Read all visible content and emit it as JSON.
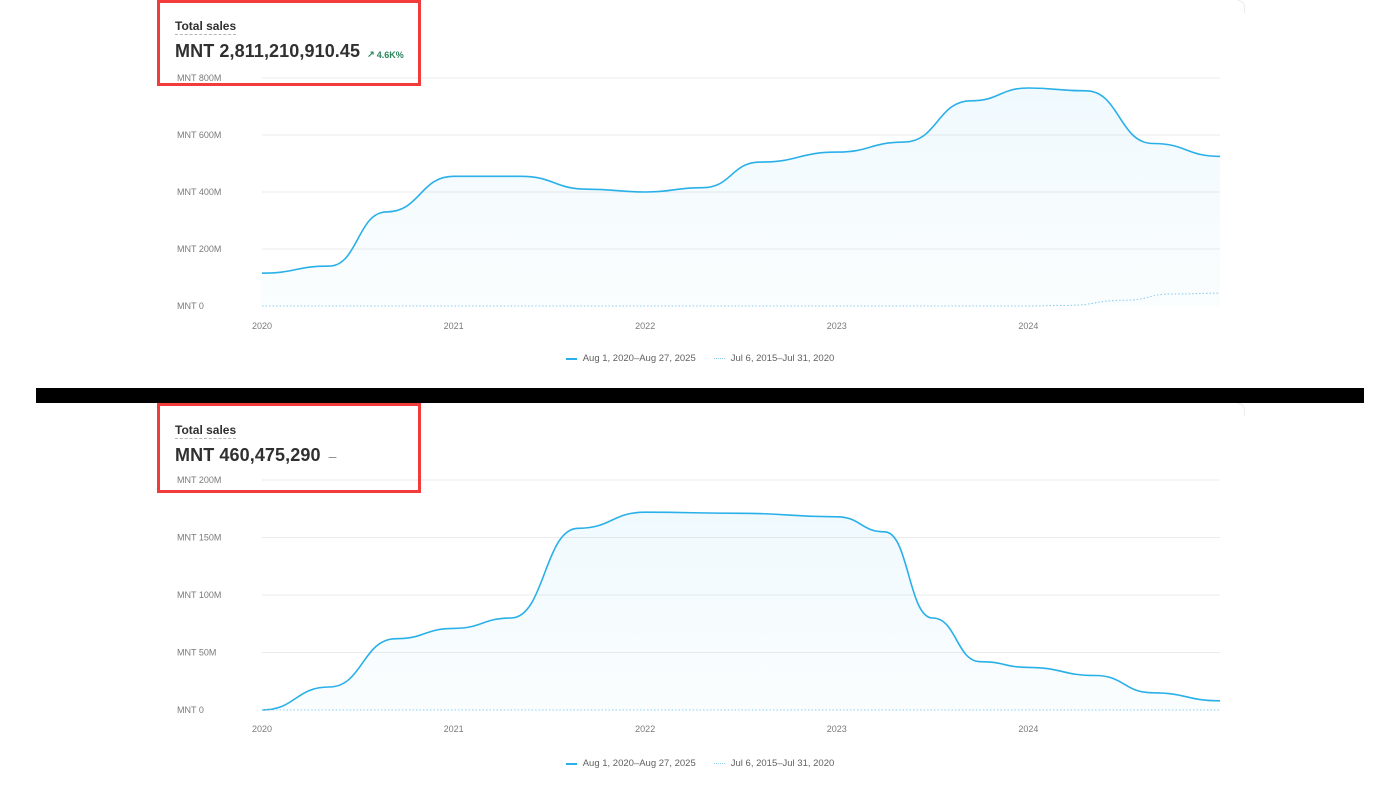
{
  "colors": {
    "primary_line": "#29b0e8",
    "comparison_line": "#8ccdf0",
    "positive_change": "#29845a",
    "highlight_box": "#f23b3b",
    "grid": "#ebebeb"
  },
  "panels": [
    {
      "metric_title": "Total sales",
      "metric_value": "MNT 2,811,210,910.45",
      "change_icon": "arrow-up-right-icon",
      "change_text": "4.6K%",
      "dash_text": ""
    },
    {
      "metric_title": "Total sales",
      "metric_value": "MNT 460,475,290",
      "change_icon": "",
      "change_text": "",
      "dash_text": "–"
    }
  ],
  "legend": {
    "current_label": "Aug 1, 2020–Aug 27, 2025",
    "previous_label": "Jul 6, 2015–Jul 31, 2020"
  },
  "chart_data": [
    {
      "type": "area",
      "title": "Total sales",
      "xlabel": "",
      "ylabel": "",
      "x_ticks": [
        "2020",
        "2021",
        "2022",
        "2023",
        "2024"
      ],
      "y_ticks": [
        "MNT 0",
        "MNT 200M",
        "MNT 400M",
        "MNT 600M",
        "MNT 800M"
      ],
      "ylim": [
        0,
        800000000
      ],
      "grid": true,
      "legend_position": "bottom-center",
      "series": [
        {
          "name": "Aug 1, 2020–Aug 27, 2025",
          "style": "solid-area",
          "x": [
            2020.0,
            2020.35,
            2020.65,
            2021.0,
            2021.35,
            2021.7,
            2022.0,
            2022.3,
            2022.6,
            2023.0,
            2023.35,
            2023.7,
            2024.0,
            2024.3,
            2024.65,
            2025.0
          ],
          "y": [
            115000000,
            140000000,
            330000000,
            455000000,
            455000000,
            410000000,
            400000000,
            415000000,
            505000000,
            540000000,
            575000000,
            720000000,
            765000000,
            755000000,
            570000000,
            525000000
          ]
        },
        {
          "name": "Jul 6, 2015–Jul 31, 2020",
          "style": "dotted",
          "x": [
            2020.0,
            2021.0,
            2022.0,
            2023.0,
            2024.0,
            2024.2,
            2024.5,
            2024.75,
            2025.0
          ],
          "y": [
            0,
            0,
            0,
            0,
            0,
            2000000,
            20000000,
            42000000,
            45000000
          ]
        }
      ]
    },
    {
      "type": "area",
      "title": "Total sales",
      "xlabel": "",
      "ylabel": "",
      "x_ticks": [
        "2020",
        "2021",
        "2022",
        "2023",
        "2024"
      ],
      "y_ticks": [
        "MNT 0",
        "MNT 50M",
        "MNT 100M",
        "MNT 150M",
        "MNT 200M"
      ],
      "ylim": [
        0,
        200000000
      ],
      "grid": true,
      "legend_position": "bottom-center",
      "series": [
        {
          "name": "Aug 1, 2020–Aug 27, 2025",
          "style": "solid-area",
          "x": [
            2020.0,
            2020.35,
            2020.7,
            2021.0,
            2021.3,
            2021.65,
            2022.0,
            2022.5,
            2023.0,
            2023.25,
            2023.5,
            2023.75,
            2024.0,
            2024.35,
            2024.65,
            2025.0
          ],
          "y": [
            0,
            20000000,
            62000000,
            71000000,
            80000000,
            158000000,
            172000000,
            171000000,
            168000000,
            155000000,
            80000000,
            42000000,
            37000000,
            30000000,
            15000000,
            8000000
          ]
        },
        {
          "name": "Jul 6, 2015–Jul 31, 2020",
          "style": "dotted",
          "x": [
            2020.0,
            2021.0,
            2022.0,
            2023.0,
            2024.0,
            2025.0
          ],
          "y": [
            0,
            0,
            0,
            0,
            0,
            0
          ]
        }
      ]
    }
  ]
}
